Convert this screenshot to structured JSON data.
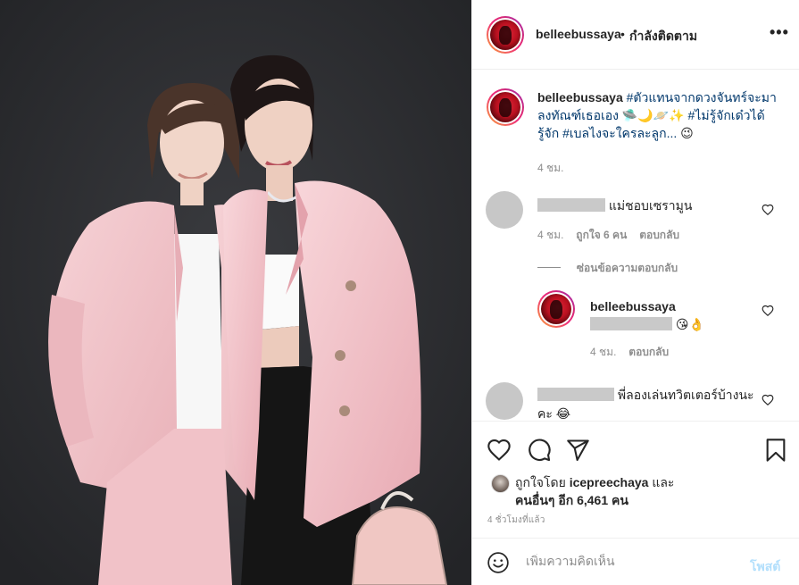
{
  "post": {
    "username": "belleebussaya",
    "dot": "•",
    "follow_status": "กำลังติดตาม",
    "more": "•••"
  },
  "caption": {
    "username": "belleebussaya",
    "text_part1": "#ตัวแทนจากดวงจันทร์จะมาลงทัณฑ์เธอเอง",
    "emojis1": "🛸🌙🪐✨",
    "text_part2": "#ไม่รู้จักเด๋วได้รู้จัก #เบลไงจะใครละลูก...",
    "emoji_end": "😉",
    "time": "4 ชม."
  },
  "comments": [
    {
      "text": "แม่ชอบเซรามูน",
      "time": "4 ชม.",
      "likes": "ถูกใจ 6 คน",
      "reply": "ตอบกลับ",
      "hide_replies": "ซ่อนข้อความตอบกลับ",
      "replies": [
        {
          "username": "belleebussaya",
          "emojis": "😘👌",
          "time": "4 ชม.",
          "reply": "ตอบกลับ"
        }
      ]
    },
    {
      "text": "พี่ลองเล่นทวิตเตอร์บ้างนะคะ",
      "emoji": "😂"
    }
  ],
  "likes": {
    "prefix": "ถูกใจโดย",
    "user": "icepreechaya",
    "and": "และ",
    "others": "คนอื่นๆ อีก 6,461 คน"
  },
  "timestamp": "4 ชั่วโมงที่แล้ว",
  "add_comment": {
    "placeholder": "เพิ่มความคิดเห็น",
    "post_label": "โพสต์"
  },
  "colors": {
    "hashtag": "#00376b",
    "gray_text": "#8e8e8e",
    "post_disabled": "#b2dffc",
    "suit_pink": "#f2c4c9",
    "photo_bg": "#2b2c2f"
  }
}
